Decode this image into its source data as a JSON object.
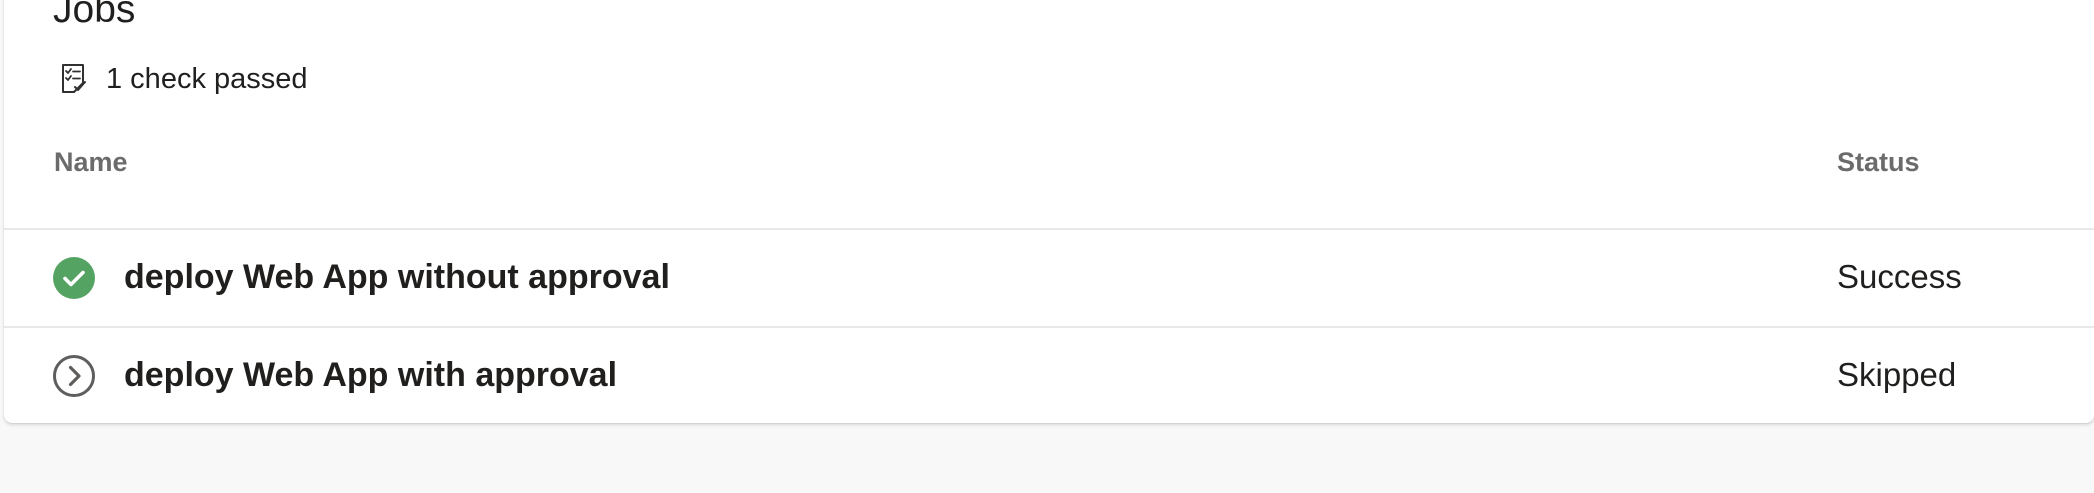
{
  "section": {
    "title": "Jobs",
    "checks_summary": "1 check passed",
    "checks_icon": "checklist-icon"
  },
  "table": {
    "columns": [
      "Name",
      "Status"
    ],
    "rows": [
      {
        "name": "deploy Web App without approval",
        "status": "Success",
        "status_icon": "success-check-icon",
        "status_color": "#55a362"
      },
      {
        "name": "deploy Web App with approval",
        "status": "Skipped",
        "status_icon": "skipped-icon",
        "status_color": "#605e5c"
      }
    ]
  }
}
